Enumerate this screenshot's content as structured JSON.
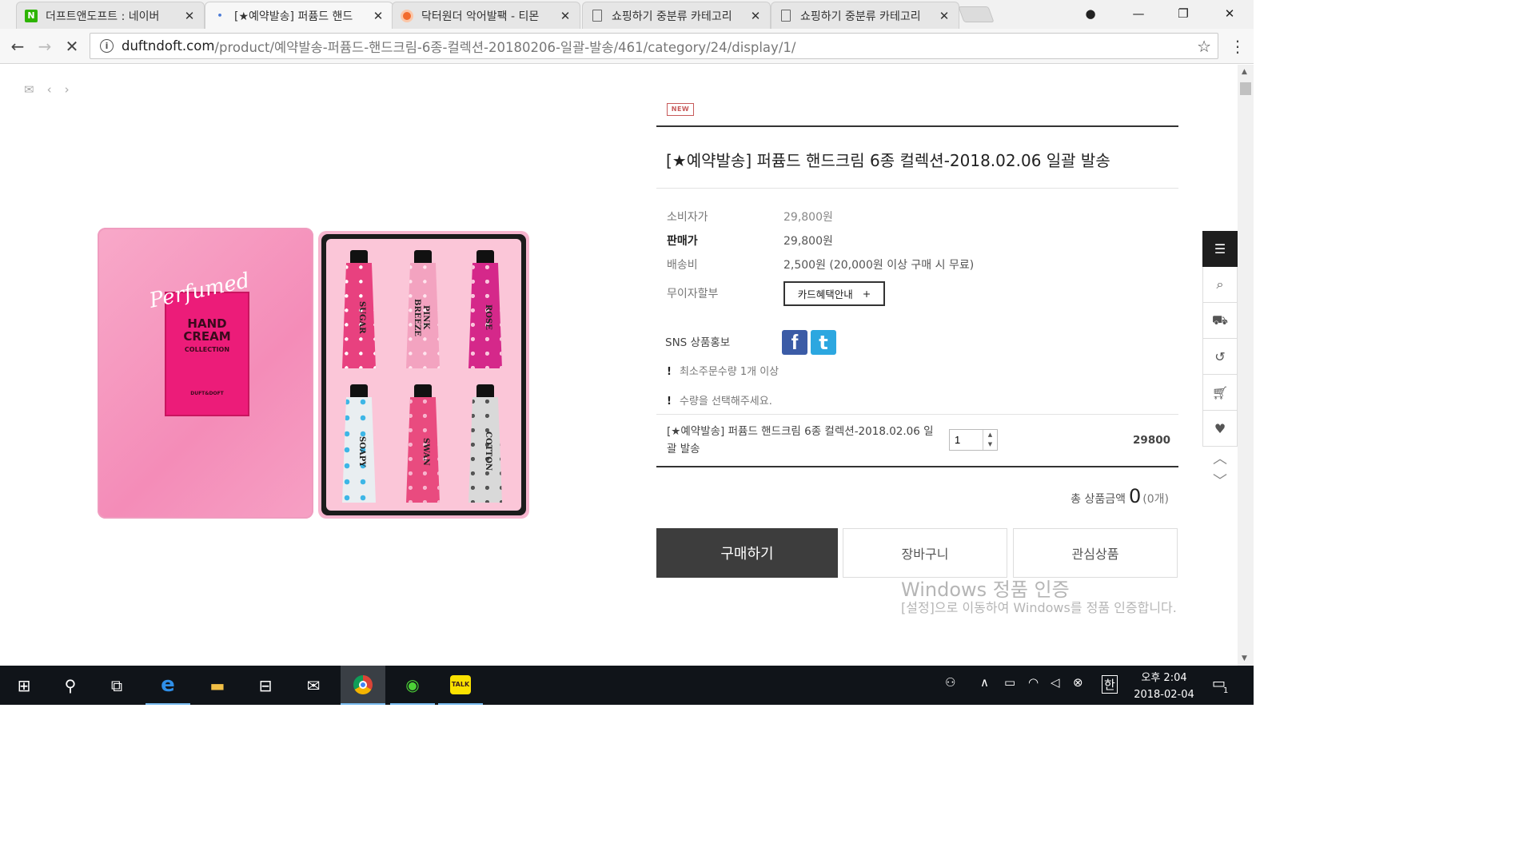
{
  "browser": {
    "tabs": [
      {
        "title": "더프트앤도프트 : 네이버",
        "favicon": "naver-n-icon"
      },
      {
        "title": "[★예약발송] 퍼퓸드 핸드",
        "favicon": "loading-dot-icon"
      },
      {
        "title": "닥터원더 악어발팩 - 티몬",
        "favicon": "tmon-circle-icon"
      },
      {
        "title": "쇼핑하기 중분류 카테고리",
        "favicon": "document-icon"
      },
      {
        "title": "쇼핑하기 중분류 카테고리",
        "favicon": "document-icon"
      }
    ],
    "url_host": "duftndoft.com",
    "url_path": "/product/예약발송-퍼퓸드-핸드크림-6종-컬렉션-20180206-일괄-발송/461/category/24/display/1/",
    "info_glyph": "i"
  },
  "lid": {
    "script": "Perfumed",
    "line1": "HAND",
    "line2": "CREAM",
    "collection": "COLLECTION",
    "brand": "DUFT&DOFT"
  },
  "tubes": [
    "SUGAR",
    "PINK BREEZE",
    "ROSE",
    "SOAPY",
    "SWAN",
    "COTTON"
  ],
  "product": {
    "badge": "NEW",
    "title": "[★예약발송] 퍼퓸드 핸드크림 6종 컬렉션-2018.02.06 일괄 발송",
    "consumer_price_label": "소비자가",
    "consumer_price": "29,800원",
    "sale_price_label": "판매가",
    "sale_price": "29,800원",
    "shipping_label": "배송비",
    "shipping": "2,500원 (20,000원 이상 구매 시 무료)",
    "installment_label": "무이자할부",
    "card_button": "카드혜택안내",
    "card_button_plus": "+",
    "sns_label": "SNS 상품홍보",
    "notice_min": "최소주문수량 1개 이상",
    "notice_select": "수량을 선택해주세요.",
    "notice_mark": "!",
    "option_name": "[★예약발송] 퍼퓸드 핸드크림 6종 컬렉션-2018.02.06 일괄 발송",
    "quantity": "1",
    "option_price": "29800",
    "total_label": "총 상품금액",
    "total_value": "0",
    "total_count": "(0개)",
    "buy_button": "구매하기",
    "cart_button": "장바구니",
    "wish_button": "관심상품"
  },
  "watermark": {
    "title": "Windows 정품 인증",
    "body": "[설정]으로 이동하여 Windows를 정품 인증합니다."
  },
  "taskbar": {
    "ime": "한",
    "clock_time": "오후 2:04",
    "clock_date": "2018-02-04",
    "notification_count": "1",
    "apps": [
      "start-icon",
      "search-icon",
      "task-view-icon",
      "edge-icon",
      "file-explorer-icon",
      "store-icon",
      "mail-icon",
      "chrome-icon",
      "wechat-icon",
      "kakaotalk-icon"
    ]
  },
  "colors": {
    "buy_button": "#3d3d3d",
    "badge": "#c75a5a",
    "facebook": "#3b5ba6",
    "twitter": "#2ca7e0",
    "lid_pink": "#ec1c79"
  }
}
